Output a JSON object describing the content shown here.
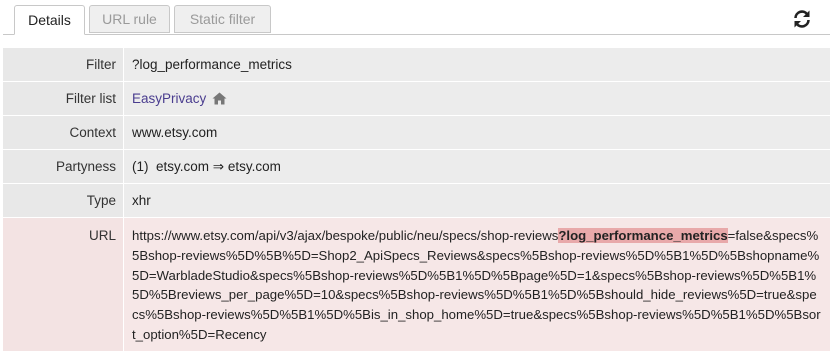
{
  "tabs": [
    {
      "label": "Details",
      "active": true
    },
    {
      "label": "URL rule",
      "active": false
    },
    {
      "label": "Static filter",
      "active": false
    }
  ],
  "rows": {
    "filter": {
      "label": "Filter",
      "value": "?log_performance_metrics"
    },
    "filter_list": {
      "label": "Filter list",
      "value": "EasyPrivacy"
    },
    "context": {
      "label": "Context",
      "value": "www.etsy.com"
    },
    "partyness": {
      "label": "Partyness",
      "value": "(1)  etsy.com ⇒ etsy.com"
    },
    "type": {
      "label": "Type",
      "value": "xhr"
    },
    "url": {
      "label": "URL",
      "prefix": "https://www.etsy.com/api/v3/ajax/bespoke/public/neu/specs/shop-reviews",
      "match": "?log_performance_metrics",
      "suffix": "=false&specs%5Bshop-reviews%5D%5B%5D=Shop2_ApiSpecs_Reviews&specs%5Bshop-reviews%5D%5B1%5D%5Bshopname%5D=WarbladeStudio&specs%5Bshop-reviews%5D%5B1%5D%5Bpage%5D=1&specs%5Bshop-reviews%5D%5B1%5D%5Breviews_per_page%5D=10&specs%5Bshop-reviews%5D%5B1%5D%5Bshould_hide_reviews%5D=true&specs%5Bshop-reviews%5D%5B1%5D%5Bis_in_shop_home%5D=true&specs%5Bshop-reviews%5D%5B1%5D%5Bsort_option%5D=Recency"
    }
  },
  "icons": {
    "refresh": "refresh-icon",
    "home": "home-icon"
  },
  "colors": {
    "highlight": "#e8a9aa",
    "link": "#4a3d8f"
  }
}
